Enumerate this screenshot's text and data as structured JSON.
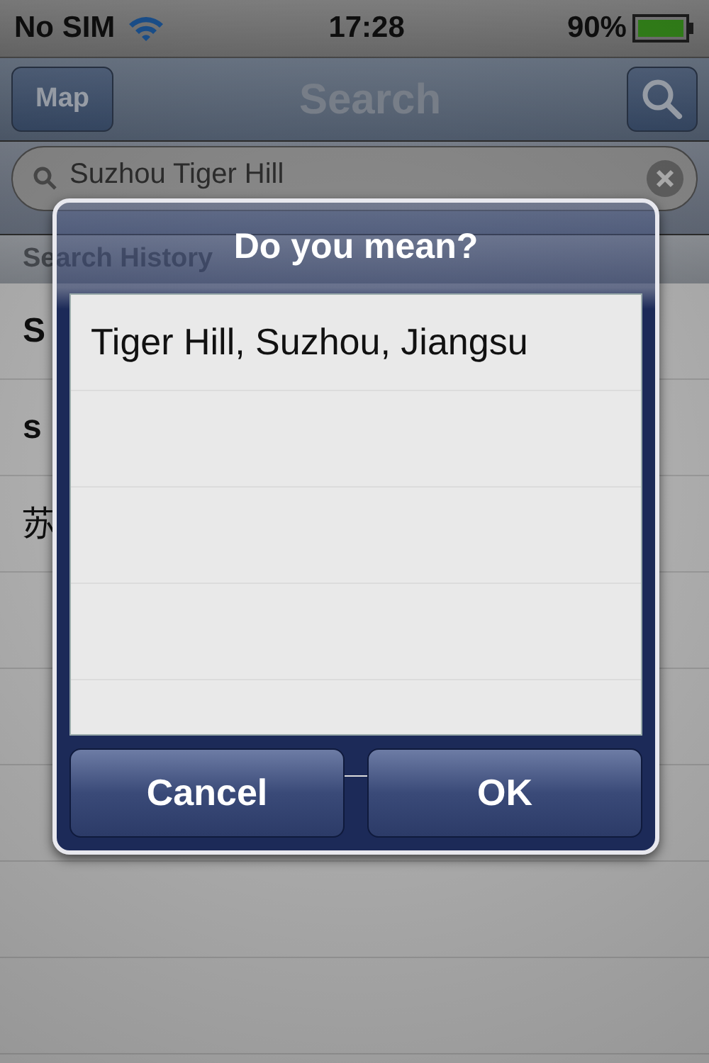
{
  "status_bar": {
    "carrier": "No SIM",
    "time": "17:28",
    "battery": "90%"
  },
  "nav_bar": {
    "left_button": "Map",
    "title": "Search"
  },
  "search": {
    "value": "Suzhou Tiger Hill"
  },
  "history": {
    "header": "Search History",
    "items": [
      "S",
      "s",
      "苏"
    ]
  },
  "dialog": {
    "title": "Do you mean?",
    "options": [
      "Tiger Hill, Suzhou, Jiangsu"
    ],
    "buttons": [
      "Cancel",
      "OK"
    ]
  }
}
